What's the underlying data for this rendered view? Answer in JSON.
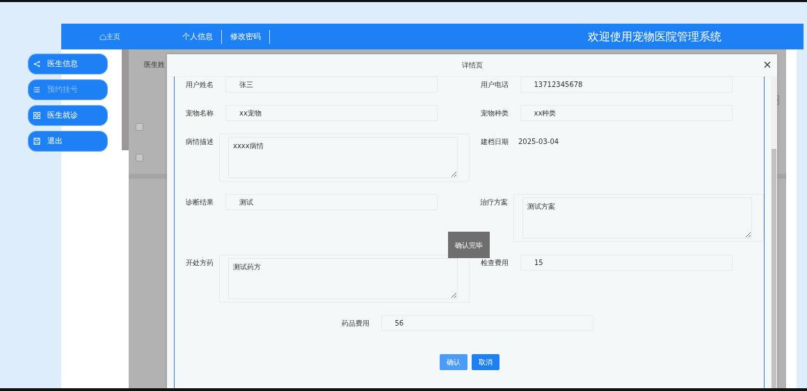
{
  "header": {
    "home": "主页",
    "links": [
      {
        "label": "个人信息"
      },
      {
        "label": "修改密码"
      }
    ],
    "title": "欢迎使用宠物医院管理系统"
  },
  "sidebar": {
    "items": [
      {
        "label": "医生信息",
        "kind": "share",
        "selected": false
      },
      {
        "label": "预约挂号",
        "kind": "list",
        "selected": true
      },
      {
        "label": "医生就诊",
        "kind": "grid",
        "selected": false
      },
      {
        "label": "退出",
        "kind": "book",
        "selected": false
      }
    ]
  },
  "backdrop": {
    "column_1": "医生姓",
    "rows": [
      {
        "checked": false
      },
      {
        "checked": false
      }
    ]
  },
  "modal": {
    "title": "详情页",
    "rows": [
      [
        {
          "label": "用户姓名",
          "value": "张三",
          "kind": "input"
        },
        {
          "label": "用户电话",
          "value": "13712345678",
          "kind": "input"
        }
      ],
      [
        {
          "label": "宠物名称",
          "value": "xx宠物",
          "kind": "input"
        },
        {
          "label": "宠物种类",
          "value": "xx种类",
          "kind": "input"
        }
      ],
      [
        {
          "label": "病情描述",
          "value": "xxxx病情",
          "kind": "textarea"
        },
        {
          "label": "建档日期",
          "value": "2025-03-04",
          "kind": "text"
        }
      ],
      [
        {
          "label": "诊断结果",
          "value": "测试",
          "kind": "input"
        },
        {
          "label": "治疗方案",
          "value": "测试方案",
          "kind": "textarea"
        }
      ],
      [
        {
          "label": "开处方药",
          "value": "测试药方",
          "kind": "textarea"
        },
        {
          "label": "检查费用",
          "value": "15",
          "kind": "input"
        }
      ],
      [
        {
          "label": "药品费用",
          "value": "56",
          "kind": "input"
        }
      ]
    ],
    "toast": "确认完毕",
    "buttons": [
      {
        "label": "确认",
        "highlighted": true
      },
      {
        "label": "取消",
        "highlighted": false
      }
    ]
  }
}
